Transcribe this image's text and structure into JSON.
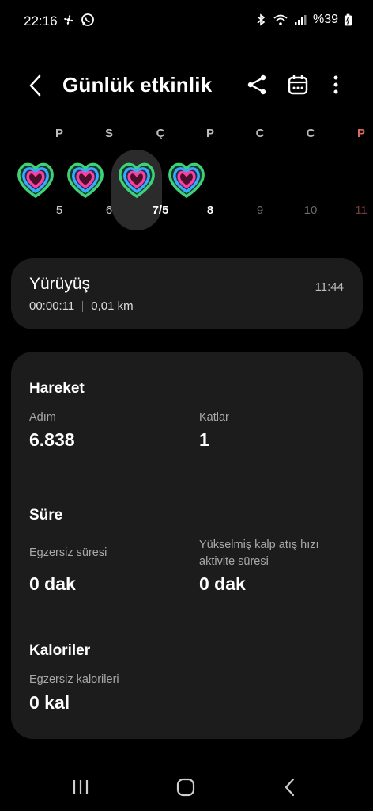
{
  "status": {
    "time": "22:16",
    "battery": "%39",
    "left_icons": [
      "fan-icon",
      "whatsapp-icon"
    ],
    "right_icons": [
      "bluetooth-icon",
      "wifi-icon",
      "signal-icon",
      "battery-icon"
    ]
  },
  "header": {
    "title": "Günlük etkinlik"
  },
  "week": [
    {
      "letter": "P",
      "num": "5",
      "state": "past"
    },
    {
      "letter": "S",
      "num": "6",
      "state": "past"
    },
    {
      "letter": "Ç",
      "num": "7/5",
      "state": "selected"
    },
    {
      "letter": "P",
      "num": "8",
      "state": "today"
    },
    {
      "letter": "C",
      "num": "9",
      "state": "future"
    },
    {
      "letter": "C",
      "num": "10",
      "state": "future"
    },
    {
      "letter": "P",
      "num": "11",
      "state": "future-sunday"
    }
  ],
  "walk": {
    "name": "Yürüyüş",
    "duration": "00:00:11",
    "distance": "0,01 km",
    "time": "11:44"
  },
  "sections": {
    "hareket": {
      "title": "Hareket",
      "steps_label": "Adım",
      "steps_value": "6.838",
      "floors_label": "Katlar",
      "floors_value": "1"
    },
    "sure": {
      "title": "Süre",
      "exercise_label": "Egzersiz süresi",
      "exercise_value": "0 dak",
      "hr_label_1": "Yükselmiş kalp atış hızı",
      "hr_label_2": "aktivite süresi",
      "hr_value": "0 dak"
    },
    "kaloriler": {
      "title": "Kaloriler",
      "label": "Egzersiz kalorileri",
      "value": "0 kal"
    }
  },
  "colors": {
    "background": "#000000",
    "card": "#1c1c1c",
    "ring_outer": "#3ed17a",
    "ring_mid": "#3aa8ff",
    "ring_inner": "#ff3fa0"
  }
}
